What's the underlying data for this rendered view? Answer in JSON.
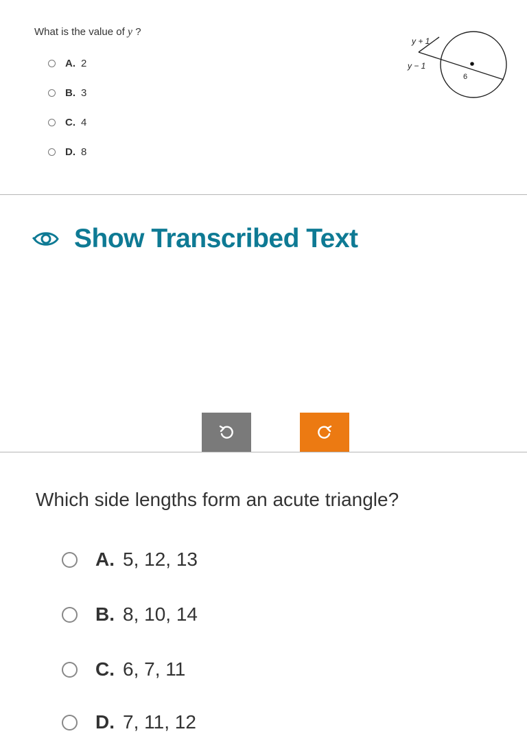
{
  "question1": {
    "prompt_before": "What is the value of ",
    "variable": "y",
    "prompt_after": "?",
    "options": [
      {
        "letter": "A.",
        "value": "2"
      },
      {
        "letter": "B.",
        "value": "3"
      },
      {
        "letter": "C.",
        "value": "4"
      },
      {
        "letter": "D.",
        "value": "8"
      }
    ],
    "diagram": {
      "label_top": "y + 1",
      "label_bottom": "y − 1",
      "label_chord": "6"
    }
  },
  "transcribed": {
    "label": "Show Transcribed Text",
    "icon": "eye-icon"
  },
  "controls": {
    "rotate_left_icon": "rotate-left-icon",
    "rotate_right_icon": "rotate-right-icon",
    "colors": {
      "grey": "#7a7a7a",
      "orange": "#ec7a12",
      "link": "#0e7a94"
    }
  },
  "question2": {
    "prompt": "Which side lengths form an acute triangle?",
    "options": [
      {
        "letter": "A.",
        "value": "5, 12, 13"
      },
      {
        "letter": "B.",
        "value": "8, 10, 14"
      },
      {
        "letter": "C.",
        "value": "6, 7, 11"
      },
      {
        "letter": "D.",
        "value": "7, 11, 12"
      }
    ]
  }
}
